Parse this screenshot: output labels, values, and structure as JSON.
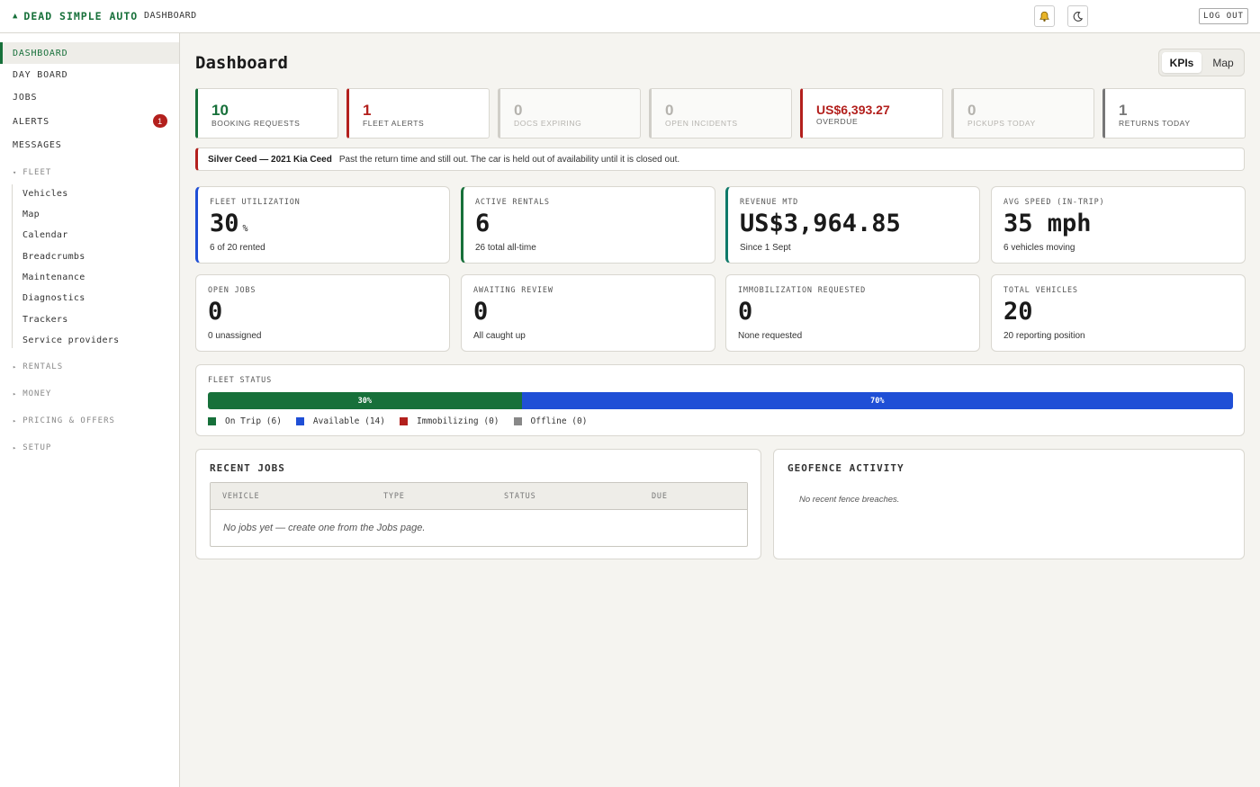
{
  "topbar": {
    "brand": "DEAD SIMPLE AUTO",
    "brand_icon": "car-icon",
    "breadcrumb": "DASHBOARD",
    "logout": "LOG OUT",
    "icons": [
      "bell-icon",
      "moon-icon"
    ]
  },
  "sidebar": {
    "items": [
      {
        "label": "DASHBOARD"
      },
      {
        "label": "DAY BOARD"
      },
      {
        "label": "JOBS"
      },
      {
        "label": "ALERTS",
        "badge": "1"
      },
      {
        "label": "MESSAGES"
      }
    ],
    "groups": {
      "fleet": "FLEET",
      "rentals": "RENTALS",
      "money": "MONEY",
      "pricing": "PRICING & OFFERS",
      "setup": "SETUP"
    },
    "fleet_items": [
      "Vehicles",
      "Map",
      "Calendar",
      "Breadcrumbs",
      "Maintenance",
      "Diagnostics",
      "Trackers",
      "Service providers"
    ]
  },
  "page": {
    "title": "Dashboard",
    "toggle": {
      "kpis": "KPIs",
      "map": "Map"
    }
  },
  "kpis": [
    {
      "value": "10",
      "label": "BOOKING REQUESTS",
      "color": "#17703a"
    },
    {
      "value": "1",
      "label": "FLEET ALERTS",
      "color": "#b3201d"
    },
    {
      "value": "0",
      "label": "DOCS EXPIRING",
      "color": "#d0cec8"
    },
    {
      "value": "0",
      "label": "OPEN INCIDENTS",
      "color": "#d0cec8"
    },
    {
      "value": "US$6,393.27",
      "label": "OVERDUE",
      "color": "#b3201d"
    },
    {
      "value": "0",
      "label": "PICKUPS TODAY",
      "color": "#d0cec8"
    },
    {
      "value": "1",
      "label": "RETURNS TODAY",
      "color": "#777777"
    }
  ],
  "alert": {
    "vehicle": "Silver Ceed — 2021 Kia Ceed",
    "message": "Past the return time and still out. The car is held out of availability until it is closed out."
  },
  "cards": {
    "utilization": {
      "label": "FLEET UTILIZATION",
      "value": "30",
      "unit": "%",
      "sub": "6 of 20 rented"
    },
    "active": {
      "label": "ACTIVE RENTALS",
      "value": "6",
      "sub": "26 total all-time"
    },
    "revenue": {
      "label": "REVENUE MTD",
      "value": "US$3,964.85",
      "sub": "Since 1 Sept"
    },
    "speed": {
      "label": "AVG SPEED (IN-TRIP)",
      "value": "35 mph",
      "sub": "6 vehicles moving"
    },
    "open_jobs": {
      "label": "OPEN JOBS",
      "value": "0",
      "sub": "0 unassigned"
    },
    "review": {
      "label": "AWAITING REVIEW",
      "value": "0",
      "sub": "All caught up"
    },
    "immob": {
      "label": "IMMOBILIZATION REQUESTED",
      "value": "0",
      "sub": "None requested"
    },
    "total": {
      "label": "TOTAL VEHICLES",
      "value": "20",
      "sub": "20 reporting position"
    }
  },
  "fleet_status": {
    "label": "FLEET STATUS",
    "segments": [
      {
        "label": "30%",
        "fraction": 0.306,
        "color": "#17703a"
      },
      {
        "label": "70%",
        "fraction": 0.694,
        "color": "#1f4fd6"
      }
    ],
    "legend": [
      {
        "label": "On Trip (6)",
        "color": "#17703a"
      },
      {
        "label": "Available (14)",
        "color": "#1f4fd6"
      },
      {
        "label": "Immobilizing (0)",
        "color": "#b3201d"
      },
      {
        "label": "Offline (0)",
        "color": "#888888"
      }
    ]
  },
  "recent_jobs": {
    "title": "RECENT JOBS",
    "columns": [
      "VEHICLE",
      "TYPE",
      "STATUS",
      "DUE"
    ],
    "empty": "No jobs yet — create one from the Jobs page."
  },
  "geofence": {
    "title": "GEOFENCE ACTIVITY",
    "empty": "No recent fence breaches."
  }
}
